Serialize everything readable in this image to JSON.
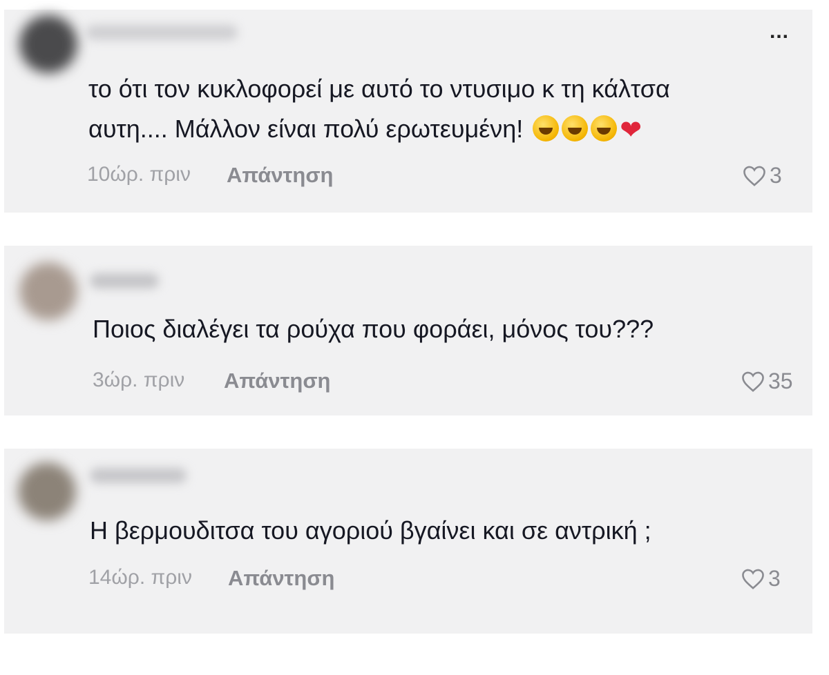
{
  "comments": [
    {
      "text": "το ότι τον κυκλοφορεί με αυτό το ντυσιμο κ τη κάλτσα",
      "text_line2": "αυτη.... Μάλλον είναι πολύ ερωτευμένη!",
      "emojis": [
        "rolling-on-floor-laughing",
        "rolling-on-floor-laughing",
        "rolling-on-floor-laughing",
        "red-heart"
      ],
      "time": "10ώρ. πριν",
      "reply": "Απάντηση",
      "likes": "3",
      "more": "..."
    },
    {
      "text": "Ποιος διαλέγει τα ρούχα που φοράει, μόνος του???",
      "time": "3ώρ. πριν",
      "reply": "Απάντηση",
      "likes": "35"
    },
    {
      "text": "Η βερμουδιτσα του αγοριού βγαίνει και σε αντρική ;",
      "time": "14ώρ. πριν",
      "reply": "Απάντηση",
      "likes": "3"
    }
  ],
  "colors": {
    "card_bg": "#f1f1f2",
    "text": "#161823",
    "muted": "#a0a1a6",
    "reply": "#8a8b91"
  }
}
